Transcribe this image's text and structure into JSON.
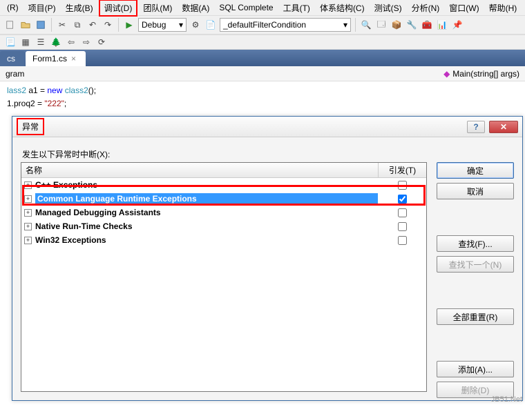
{
  "menu": {
    "items": [
      {
        "label": "(R)"
      },
      {
        "label": "项目(P)"
      },
      {
        "label": "生成(B)"
      },
      {
        "label": "调试(D)",
        "hl": true
      },
      {
        "label": "团队(M)"
      },
      {
        "label": "数据(A)"
      },
      {
        "label": "SQL Complete"
      },
      {
        "label": "工具(T)"
      },
      {
        "label": "体系结构(C)"
      },
      {
        "label": "测试(S)"
      },
      {
        "label": "分析(N)"
      },
      {
        "label": "窗口(W)"
      },
      {
        "label": "帮助(H)"
      }
    ]
  },
  "toolbar": {
    "config_combo": "Debug",
    "filter_combo": "_defaultFilterCondition"
  },
  "tabs": {
    "t0": "cs",
    "t1": "Form1.cs"
  },
  "subbar": {
    "left": "gram",
    "right": "Main(string[] args)"
  },
  "code": {
    "l1_a": "lass2",
    "l1_b": " a1 = ",
    "l1_c": "new",
    "l1_d": " ",
    "l1_e": "class2",
    "l1_f": "();",
    "l2_a": "1.proq2 = ",
    "l2_b": "\"222\"",
    "l2_c": ";"
  },
  "dialog": {
    "title": "异常",
    "prompt": "发生以下异常时中断(X):",
    "columns": {
      "name": "名称",
      "trigger": "引发(T)"
    },
    "items": [
      {
        "label": "C++ Exceptions",
        "checked": false,
        "sel": false
      },
      {
        "label": "Common Language Runtime Exceptions",
        "checked": true,
        "sel": true
      },
      {
        "label": "Managed Debugging Assistants",
        "checked": false,
        "sel": false
      },
      {
        "label": "Native Run-Time Checks",
        "checked": false,
        "sel": false
      },
      {
        "label": "Win32 Exceptions",
        "checked": false,
        "sel": false
      }
    ],
    "buttons": {
      "ok": "确定",
      "cancel": "取消",
      "find": "查找(F)...",
      "find_next": "查找下一个(N)",
      "reset_all": "全部重置(R)",
      "add": "添加(A)...",
      "delete": "删除(D)"
    },
    "help": "?",
    "close": "✕"
  },
  "watermark": "JB51.Net"
}
